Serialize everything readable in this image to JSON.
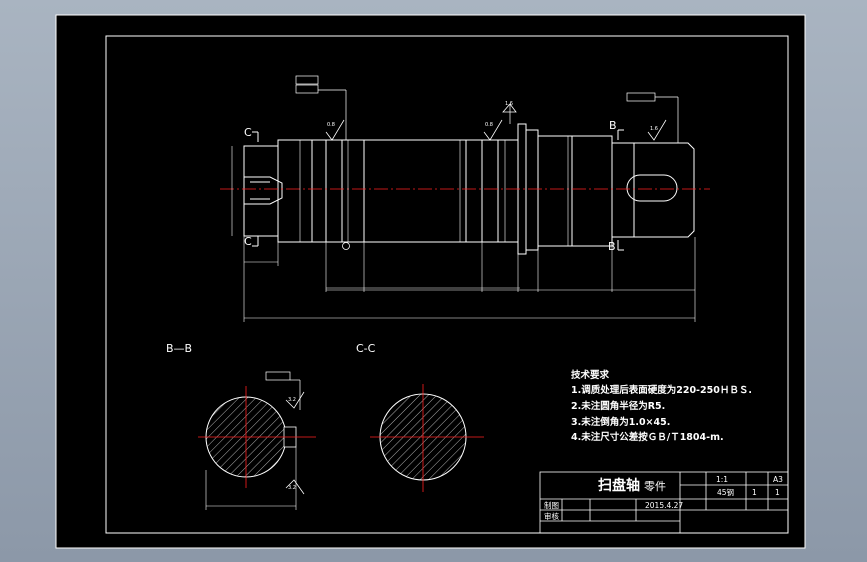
{
  "drawing": {
    "section_labels": {
      "b_view_top": "B",
      "b_view_bottom": "B",
      "c_view_top": "C",
      "c_view_bottom": "C",
      "section_bb": "B—B",
      "section_cc": "C-C"
    },
    "technical_requirements": {
      "title": "技术要求",
      "items": [
        "1.调质处理后表面硬度为220-250ＨＢＳ.",
        "2.未注圆角半径为R5.",
        "3.未注倒角为1.0×45.",
        "4.未注尺寸公差按ＧＢ/Ｔ1804-m."
      ]
    },
    "title_block": {
      "part_name": "扫盘轴",
      "part_label": "零件",
      "scale": "1:1",
      "material": "45钢",
      "sheet_size": "A3",
      "date": "2015.4.27",
      "count": "1",
      "sheet_count": "1",
      "draw_label": "制图",
      "check_label": "审核"
    },
    "roughness": [
      "0.8",
      "0.8",
      "1.6",
      "1.6",
      "3.2",
      "3.2"
    ]
  },
  "colors": {
    "frame": "#ffffff",
    "centerline": "#ff2020",
    "outline": "#ffffff",
    "background": "#000000"
  }
}
